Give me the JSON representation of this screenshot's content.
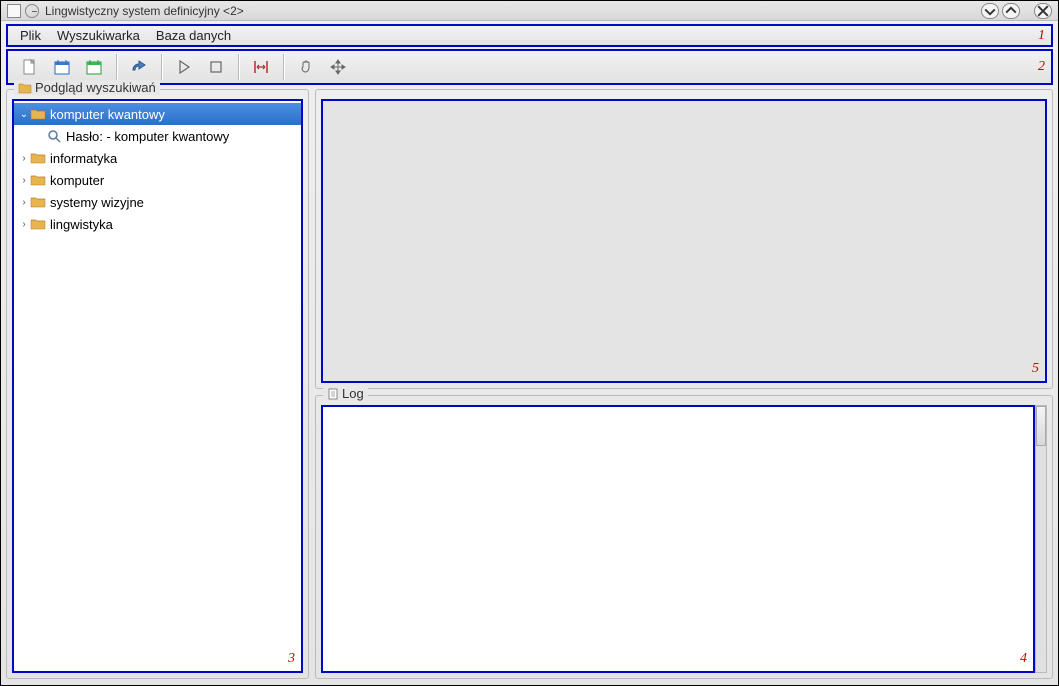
{
  "window": {
    "title": "Lingwistyczny system definicyjny  <2>"
  },
  "menubar": {
    "items": [
      "Plik",
      "Wyszukiwarka",
      "Baza danych"
    ]
  },
  "toolbar": {
    "buttons": [
      {
        "name": "new-document-icon"
      },
      {
        "name": "calendar-blue-icon"
      },
      {
        "name": "calendar-green-icon"
      },
      {
        "sep": true
      },
      {
        "name": "run-process-icon"
      },
      {
        "sep": true
      },
      {
        "name": "play-icon"
      },
      {
        "name": "stop-icon"
      },
      {
        "sep": true
      },
      {
        "name": "fit-width-icon"
      },
      {
        "sep": true
      },
      {
        "name": "hand-tool-icon"
      },
      {
        "name": "move-tool-icon"
      }
    ]
  },
  "sidebar": {
    "title": "Podgląd wyszukiwań",
    "nodes": [
      {
        "label": "komputer kwantowy",
        "expanded": true,
        "selected": true,
        "children": [
          {
            "label": "Hasło: - komputer kwantowy"
          }
        ]
      },
      {
        "label": "informatyka",
        "expanded": false
      },
      {
        "label": "komputer",
        "expanded": false
      },
      {
        "label": "systemy wizyjne",
        "expanded": false
      },
      {
        "label": "lingwistyka",
        "expanded": false
      }
    ]
  },
  "log": {
    "title": "Log"
  },
  "annotations": {
    "menubar": "1",
    "toolbar": "2",
    "tree": "3",
    "log": "4",
    "canvas": "5"
  }
}
